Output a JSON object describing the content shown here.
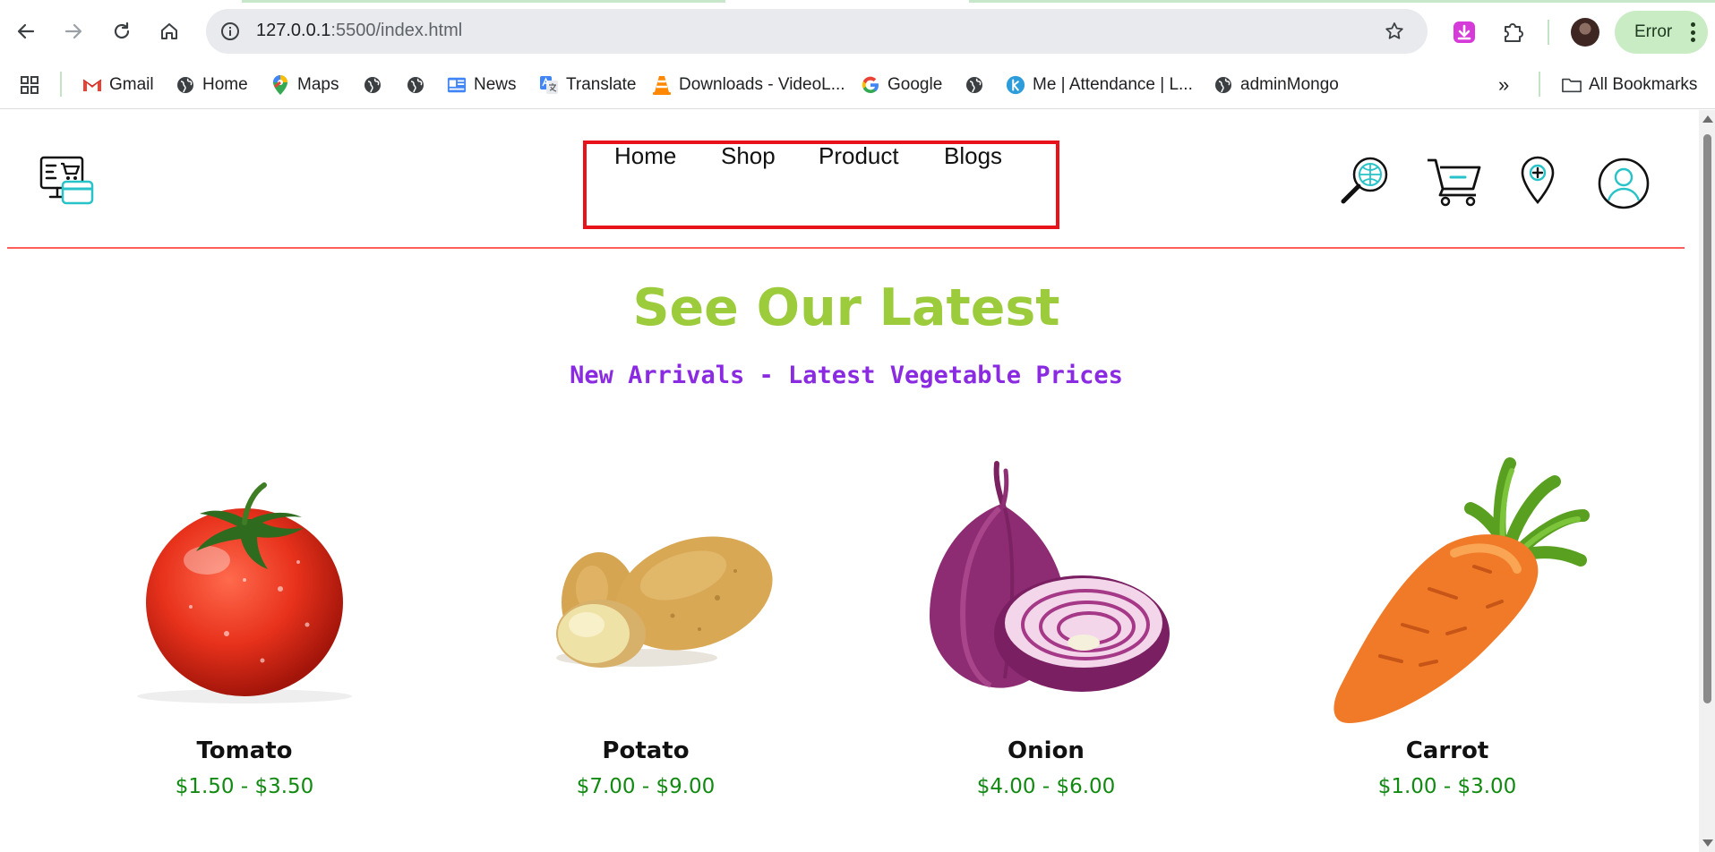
{
  "browser": {
    "url_host": "127.0.0.1",
    "url_rest": ":5500/index.html",
    "profile_status": "Error",
    "icons": {
      "back": "arrow-left-icon",
      "forward": "arrow-right-icon",
      "reload": "reload-icon",
      "home": "home-icon",
      "site_info": "info-icon",
      "bookmark_star": "star-icon",
      "download_extension": "download-icon",
      "extensions": "puzzle-icon",
      "profile": "avatar",
      "menu": "kebab-menu-icon"
    },
    "accent_color": "#c9ecc5"
  },
  "bookmarks": {
    "items": [
      {
        "label": "Gmail",
        "icon": "gmail-icon"
      },
      {
        "label": "Home",
        "icon": "globe-icon"
      },
      {
        "label": "Maps",
        "icon": "maps-pin-icon"
      },
      {
        "label": "",
        "icon": "globe-icon"
      },
      {
        "label": "",
        "icon": "globe-icon"
      },
      {
        "label": "News",
        "icon": "news-icon"
      },
      {
        "label": "Translate",
        "icon": "translate-icon"
      },
      {
        "label": "Downloads - VideoL...",
        "icon": "vlc-cone-icon"
      },
      {
        "label": "Google",
        "icon": "google-icon"
      },
      {
        "label": "",
        "icon": "globe-icon"
      },
      {
        "label": "Me | Attendance | L...",
        "icon": "k-circle-icon"
      },
      {
        "label": "adminMongo",
        "icon": "globe-icon"
      }
    ],
    "overflow": "»",
    "all_bookmarks": "All Bookmarks"
  },
  "site": {
    "logo_icon": "online-shop-icon",
    "nav": [
      "Home",
      "Shop",
      "Product",
      "Blogs"
    ],
    "header_icons": [
      "globe-search-icon",
      "cart-icon",
      "location-pin-icon",
      "user-icon"
    ],
    "nav_highlight_color": "#e8121a",
    "divider_color": "#ff5c5c"
  },
  "hero": {
    "title": "See Our Latest",
    "subtitle": "New Arrivals - Latest Vegetable Prices",
    "title_color": "#9ccc3c",
    "subtitle_color": "#8a2be2"
  },
  "products": [
    {
      "name": "Tomato",
      "price": "$1.50 - $3.50",
      "image": "tomato-image"
    },
    {
      "name": "Potato",
      "price": "$7.00 - $9.00",
      "image": "potato-image"
    },
    {
      "name": "Onion",
      "price": "$4.00 - $6.00",
      "image": "onion-image"
    },
    {
      "name": "Carrot",
      "price": "$1.00 - $3.00",
      "image": "carrot-image"
    }
  ],
  "price_color": "#128a12"
}
